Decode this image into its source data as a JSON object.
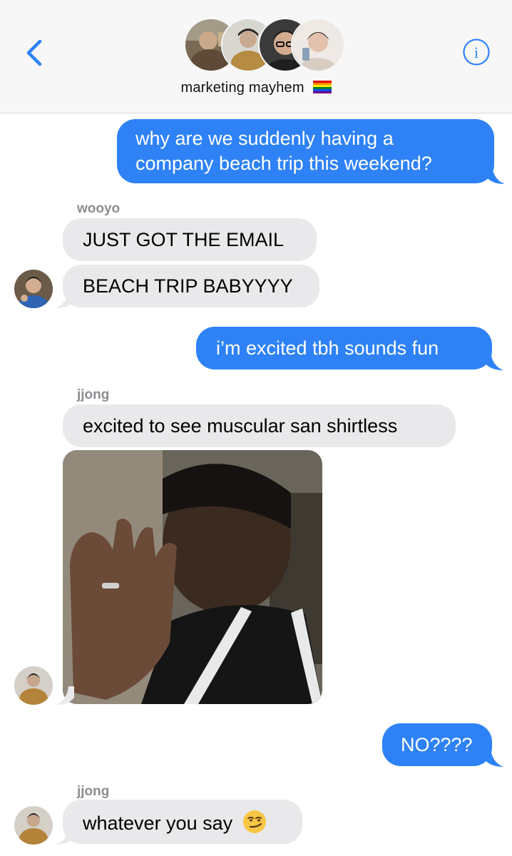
{
  "header": {
    "group_name": "marketing mayhem",
    "back_icon": "chevron-left-icon",
    "info_icon": "info-circle-icon",
    "accent_color": "#2e82f6"
  },
  "messages": {
    "m1": {
      "line1": "why are we suddenly having a",
      "line2": "company beach trip this weekend?"
    },
    "sender_wooyo": "wooyo",
    "m2": "JUST GOT THE EMAIL",
    "m3": "BEACH TRIP BABYYYY",
    "m4": "i’m excited tbh sounds fun",
    "sender_jjong_1": "jjong",
    "m5": "excited to see muscular san shirtless",
    "m6_image": "reaction-photo",
    "m7": "NO????",
    "sender_jjong_2": "jjong",
    "m8": "whatever you say"
  },
  "colors": {
    "sent_bubble": "#2e82f6",
    "received_bubble": "#e9e9eb",
    "sender_name": "#8d8d92"
  }
}
